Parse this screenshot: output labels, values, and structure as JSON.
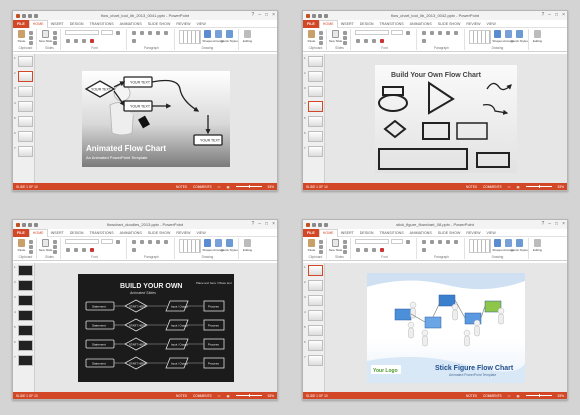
{
  "tabs": [
    "FILE",
    "HOME",
    "INSERT",
    "DESIGN",
    "TRANSITIONS",
    "ANIMATIONS",
    "SLIDE SHOW",
    "REVIEW",
    "VIEW"
  ],
  "ribbon": {
    "paste": "Paste",
    "new_slide": "New Slide",
    "shapes": "Shapes",
    "arrange": "Arrange",
    "quick_styles": "Quick Styles",
    "editing": "Editing",
    "groups": [
      "Clipboard",
      "Slides",
      "Font",
      "Paragraph",
      "Drawing"
    ]
  },
  "window_controls": [
    "?",
    "–",
    "□",
    "×"
  ],
  "windows": [
    {
      "title": "flow_chart_tool_lib_2013_0041.pptx - PowerPoint",
      "status_left": "SLIDE 1 OF 10",
      "notes": "NOTES",
      "comments": "COMMENTS",
      "zoom": "53%",
      "slide": {
        "title": "Animated Flow Chart",
        "subtitle": "An Animated PowerPoint Template",
        "boxes": [
          "YOUR TEXT",
          "YOUR TEXT",
          "YOUR TEXT",
          "YOUR TEXT"
        ]
      }
    },
    {
      "title": "flow_chart_tool_lib_2013_0042.pptx - PowerPoint",
      "status_left": "SLIDE 1 OF 10",
      "notes": "NOTES",
      "comments": "COMMENTS",
      "zoom": "53%",
      "slide": {
        "title": "Build Your Own Flow Chart"
      }
    },
    {
      "title": "flowchart_doodles_2013.pptx - PowerPoint",
      "status_left": "SLIDE 1 OF 10",
      "notes": "NOTES",
      "comments": "COMMENTS",
      "zoom": "53%",
      "slide": {
        "title": "BUILD YOUR OWN",
        "subtitle": "Animated Slides",
        "callout": "Place text here / Place text",
        "col_labels": [
          "Statement",
          "START HERE",
          "Input / Output",
          "Process"
        ]
      }
    },
    {
      "title": "stick_figure_flowchart_08.pptx - PowerPoint",
      "status_left": "SLIDE 1 OF 10",
      "notes": "NOTES",
      "comments": "COMMENTS",
      "zoom": "53%",
      "slide": {
        "title": "Stick Figure Flow Chart",
        "subtitle": "Animated PowerPoint Template",
        "logo": "Your Logo"
      }
    }
  ]
}
